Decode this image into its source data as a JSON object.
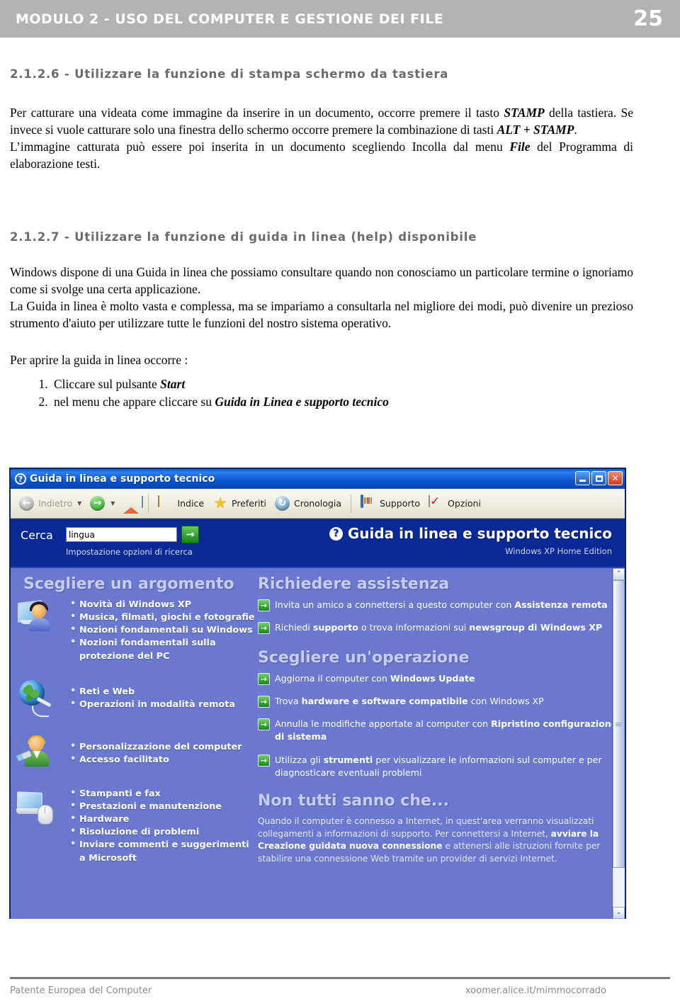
{
  "header": {
    "title": "MODULO 2 - USO DEL COMPUTER E GESTIONE DEI FILE",
    "page_number": "25"
  },
  "sections": [
    {
      "id": "s1",
      "heading": "2.1.2.6 - Utilizzare la funzione di stampa schermo da tastiera"
    },
    {
      "id": "s2",
      "heading": "2.1.2.7 - Utilizzare la funzione di guida in linea (help) disponibile"
    }
  ],
  "paragraphs": {
    "p1_a": "Per catturare una videata come immagine da inserire in un documento, occorre premere il tasto ",
    "p1_b": "STAMP",
    "p1_c": " della tastiera. Se invece si vuole catturare solo una finestra dello schermo occorre premere la combinazione di tasti ",
    "p1_d": "ALT + STAMP",
    "p1_e": ".",
    "p1_f": "L’immagine catturata può essere poi inserita in un documento scegliendo Incolla dal menu ",
    "p1_g": "File",
    "p1_h": " del Programma di elaborazione testi.",
    "p2": "Windows dispone di una Guida in linea che possiamo consultare quando non conosciamo un particolare termine o ignoriamo come si svolge una certa applicazione.",
    "p2b": "La Guida in linea è molto vasta e complessa, ma se impariamo a consultarla nel migliore dei modi, può divenire un prezioso strumento d'aiuto per utilizzare tutte le funzioni del nostro sistema operativo.",
    "p3": "Per aprire la guida in linea occorre :"
  },
  "steps": [
    {
      "text_a": "Cliccare sul pulsante ",
      "text_b": "Start"
    },
    {
      "text_a": "nel menu che appare cliccare su ",
      "text_b": "Guida in Linea e supporto tecnico"
    }
  ],
  "help_window": {
    "title": "Guida in linea e supporto tecnico",
    "window_buttons": {
      "minimize": "minimize-button",
      "maximize": "maximize-button",
      "close": "✕"
    },
    "toolbar": [
      {
        "label": "Indietro",
        "icon": "back-arrow-icon",
        "disabled": true,
        "has_caret": true
      },
      {
        "label": "",
        "icon": "forward-arrow-icon",
        "disabled": false,
        "has_caret": true
      },
      {
        "label": "",
        "icon": "home-icon",
        "disabled": false,
        "has_caret": false
      },
      {
        "label": "Indice",
        "icon": "book-icon",
        "disabled": false,
        "has_caret": false
      },
      {
        "label": "Preferiti",
        "icon": "star-icon",
        "disabled": false,
        "has_caret": false
      },
      {
        "label": "Cronologia",
        "icon": "history-icon",
        "disabled": false,
        "has_caret": false
      },
      {
        "label": "Supporto",
        "icon": "support-icon",
        "disabled": false,
        "has_caret": false
      },
      {
        "label": "Opzioni",
        "icon": "options-icon",
        "disabled": false,
        "has_caret": false
      }
    ],
    "search": {
      "label": "Cerca",
      "value": "lingua",
      "placeholder": "",
      "go_button": "→",
      "options_link": "Impostazione opzioni di ricerca"
    },
    "brand": {
      "title": "Guida in linea e supporto tecnico",
      "edition": "Windows XP Home Edition",
      "icon": "question-mark-icon"
    },
    "left_column": {
      "heading": "Scegliere un argomento",
      "groups": [
        {
          "icon": "pc-user-icon",
          "items": [
            "Novità di Windows XP",
            "Musica, filmati, giochi e fotografie",
            "Nozioni fondamentali su Windows",
            "Nozioni fondamentali sulla protezione del PC"
          ]
        },
        {
          "icon": "globe-network-icon",
          "items": [
            "Reti e Web",
            "Operazioni in modalità remota"
          ]
        },
        {
          "icon": "paint-user-icon",
          "items": [
            "Personalizzazione del computer",
            "Accesso facilitato"
          ]
        },
        {
          "icon": "laptop-mouse-icon",
          "items": [
            "Stampanti e fax",
            "Prestazioni e manutenzione",
            "Hardware",
            "Risoluzione di problemi",
            "Inviare commenti e suggerimenti a Microsoft"
          ]
        }
      ]
    },
    "right_column": {
      "assistance_heading": "Richiedere assistenza",
      "assistance_links": [
        {
          "pre": "Invita un amico a connettersi a questo computer con ",
          "strong": "Assistenza remota",
          "post": ""
        },
        {
          "pre": "Richiedi ",
          "strong": "supporto",
          "post": " o trova informazioni sui ",
          "strong2": "newsgroup di Windows XP"
        }
      ],
      "task_heading": "Scegliere un'operazione",
      "task_links": [
        {
          "pre": "Aggiorna il computer con ",
          "strong": "Windows Update",
          "post": ""
        },
        {
          "pre": "Trova ",
          "strong": "hardware e software compatibile",
          "post": " con Windows XP"
        },
        {
          "pre": "Annulla le modifiche apportate al computer con ",
          "strong": "Ripristino configurazione di sistema",
          "post": ""
        },
        {
          "pre": "Utilizza gli ",
          "strong": "strumenti",
          "post": " per visualizzare le informazioni sul computer e per diagnosticare eventuali problemi"
        }
      ],
      "tip_heading": "Non tutti sanno che...",
      "tip_pre": "Quando il computer è connesso a Internet, in quest'area verranno visualizzati collegamenti a informazioni di supporto. Per connettersi a Internet, ",
      "tip_strong": "avviare la Creazione guidata nuova connessione",
      "tip_post": " e attenersi alle istruzioni fornite per stabilire una connessione Web tramite un provider di servizi Internet.",
      "scrollbar": {
        "up": "⌃",
        "down": "⌄"
      }
    }
  },
  "footer": {
    "left": "Patente Europea del Computer",
    "right": "xoomer.alice.it/mimmocorrado"
  },
  "colors": {
    "header_band": "#b3b3b3",
    "heading_gray": "#6b6b6b",
    "xp_titlebar_blue": "#0b54cf",
    "xp_search_blue": "#0a2896",
    "xp_content_blue": "#6a79cf",
    "xp_accent_green": "#18881c"
  }
}
